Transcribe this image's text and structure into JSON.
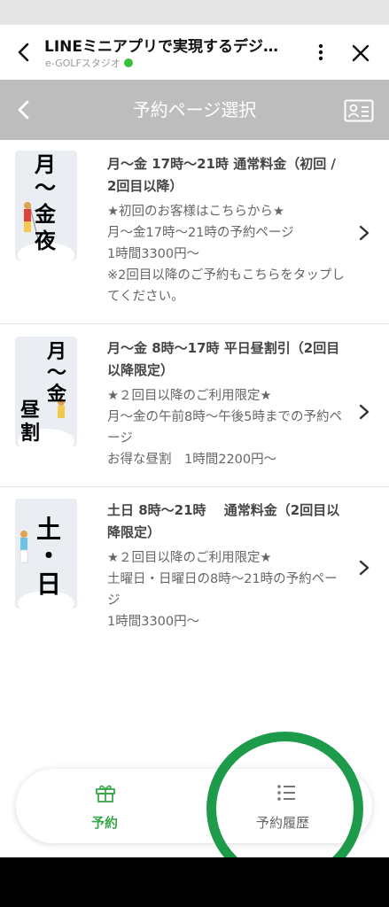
{
  "header": {
    "title": "LINEミニアプリで実現するデジ…",
    "subtitle": "e-GOLFスタジオ"
  },
  "nav": {
    "title": "予約ページ選択"
  },
  "items": [
    {
      "thumb_text": [
        "月",
        "〜",
        "金",
        "夜"
      ],
      "heading": "月〜金 17時〜21時 通常料金（初回 / 2回目以降）",
      "desc": "★初回のお客様はこちらから★\n月〜金17時〜21時の予約ページ\n1時間3300円〜\n※2回目以降のご予約もこちらをタップしてください。"
    },
    {
      "thumb_text": [
        "月",
        "〜",
        "金",
        "昼",
        "割"
      ],
      "heading": "月〜金 8時〜17時 平日昼割引（2回目以降限定）",
      "desc": "★２回目以降のご利用限定★\n月〜金の午前8時〜午後5時までの予約ページ\nお得な昼割　1時間2200円〜"
    },
    {
      "thumb_text": [
        "土",
        "・",
        "日"
      ],
      "heading": "土日 8時〜21時　 通常料金（2回目以降限定）",
      "desc": "★２回目以降のご利用限定★\n土曜日・日曜日の8時〜21時の予約ページ\n1時間3300円〜"
    }
  ],
  "tabs": {
    "reserve": "予約",
    "history": "予約履歴"
  },
  "colors": {
    "accent": "#3aa64a",
    "annotation": "#1e9a4b",
    "nav_bg": "#bdbdbd"
  }
}
